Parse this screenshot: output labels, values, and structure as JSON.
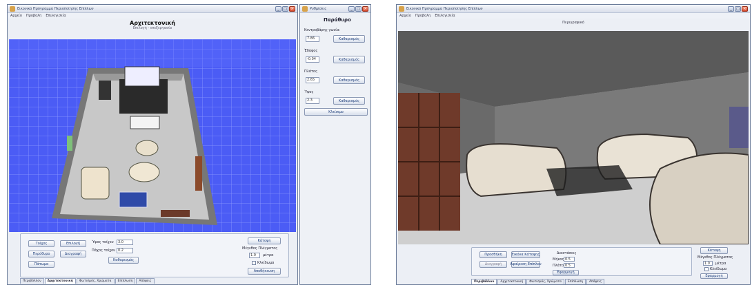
{
  "left_window": {
    "title": "Εικονικό Πρόγραμμα Περιοποίησης Επίπλων",
    "menu": [
      "Αρχείο",
      "Προβολη",
      "Επιλογισεία"
    ],
    "header_title": "Αρχιτεκτονική",
    "header_subtitle": "Επιλογή - επεξεργασία",
    "controls": {
      "wall_button": "Τοίχος",
      "select_button": "Επιλογή",
      "doors_button": "Περόθυρο",
      "delete_button": "Διαγραφή",
      "floor_button": "Πάτωμα",
      "wall_height_label": "Ύψος τοίχου",
      "wall_height_value": "3.0",
      "wall_thickness_label": "Πάχος τοίχου",
      "wall_thickness_value": "0.2",
      "clear_button": "Καθαρισμός",
      "camera_button": "Κάτοψη",
      "grid_size_label": "Μέγεθος Πλέγματος",
      "grid_value": "1.0",
      "grid_unit": "μέτρα",
      "lock_label": "Κλείδωμα",
      "save_button": "Αποθήκευση"
    },
    "tabs": [
      "Περιβάλλον",
      "Αρχιτεκτονική",
      "Φωτισμός, Χρώματα",
      "Επίπλωση",
      "Απόψεις"
    ],
    "active_tab": 1
  },
  "props_window": {
    "title": "Ρυθμίσεις",
    "header": "Παράθυρο",
    "fields": [
      {
        "label": "Κεντροβάρης γωνία:",
        "value": "7.86",
        "button": "Καθαρισμός"
      },
      {
        "label": "Έδαφος",
        "value": "-0.04",
        "button": "Καθαρισμός"
      },
      {
        "label": "Πλάτος",
        "value": "2.65",
        "button": "Καθαρισμός"
      },
      {
        "label": "Ύψος",
        "value": "2.3",
        "button": "Καθαρισμός"
      }
    ],
    "close_button": "Κλείσιμο"
  },
  "right_window": {
    "title": "Εικονικό Πρόγραμμα Περιοποίησης Επίπλων",
    "menu": [
      "Αρχείο",
      "Προβολη",
      "Επιλογισεία"
    ],
    "header_title": "Περιγραφικό",
    "controls": {
      "add_button": "Προσθήκη",
      "camera_button": "Εικόνα Κάτοψης",
      "delete_button": "Διαγραφή",
      "reset_button": "Αφαίρεση Επίπλου",
      "info_title": "Διαστάσεις",
      "width_label": "Μήκος",
      "width_value": "0.5",
      "depth_label": "Πλάτος",
      "depth_value": "0.5",
      "apply_button": "Εφαρμογή",
      "view_button": "Κάτοψη",
      "grid_size_label": "Μέγεθος Πλέγματος",
      "grid_value": "1.0",
      "grid_unit": "μέτρα",
      "lock_label": "Κλείδωμα",
      "close_button": "Εφαρμογή"
    },
    "tabs": [
      "Περιβάλλον",
      "Αρχιτεκτονική",
      "Φωτισμός, Χρώματα",
      "Επίπλωση",
      "Απόψεις"
    ],
    "active_tab": 0
  }
}
